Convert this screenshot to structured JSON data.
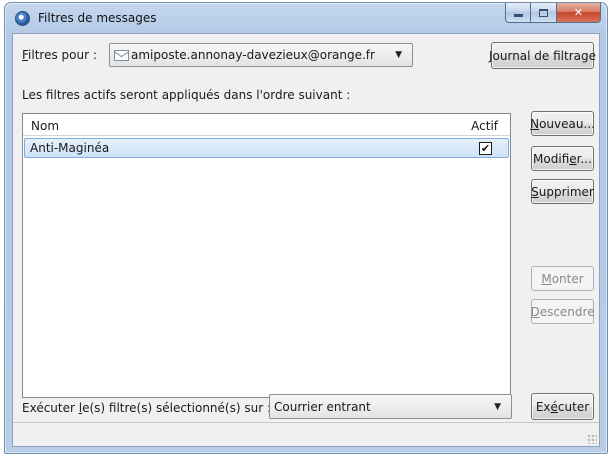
{
  "window": {
    "title": "Filtres de messages",
    "accent_close": "#c4462a",
    "selection_color": "#cde2f8"
  },
  "filters_for": {
    "label_prefix": "",
    "label_mnemonic": "F",
    "label_rest": "iltres pour :",
    "account": "amiposte.annonay-davezieux@orange.fr"
  },
  "buttons": {
    "journal_mnemonic": "J",
    "journal_rest": "ournal de filtrage",
    "new_mnemonic": "N",
    "new_rest": "ouveau...",
    "edit_prefix": "Modifi",
    "edit_mnemonic": "e",
    "edit_rest": "r...",
    "delete_mnemonic": "S",
    "delete_rest": "upprimer",
    "up_mnemonic": "M",
    "up_rest": "onter",
    "down_mnemonic": "D",
    "down_rest": "escendre",
    "run_prefix": "Ex",
    "run_mnemonic": "é",
    "run_rest": "cuter"
  },
  "info_text": "Les filtres actifs seront appliqués dans l'ordre suivant :",
  "list": {
    "col_name": "Nom",
    "col_active": "Actif",
    "rows": [
      {
        "name": "Anti-Maginéa",
        "active": true,
        "check": "✔"
      }
    ]
  },
  "run_on": {
    "label_prefix": "Exécuter ",
    "label_mnemonic": "l",
    "label_rest": "e(s) filtre(s) sélectionné(s) sur :",
    "folder": "Courrier entrant"
  },
  "icons": {
    "app": "thunderbird-icon",
    "account": "mail-envelope-icon",
    "dropdown": "chevron-down-icon"
  }
}
